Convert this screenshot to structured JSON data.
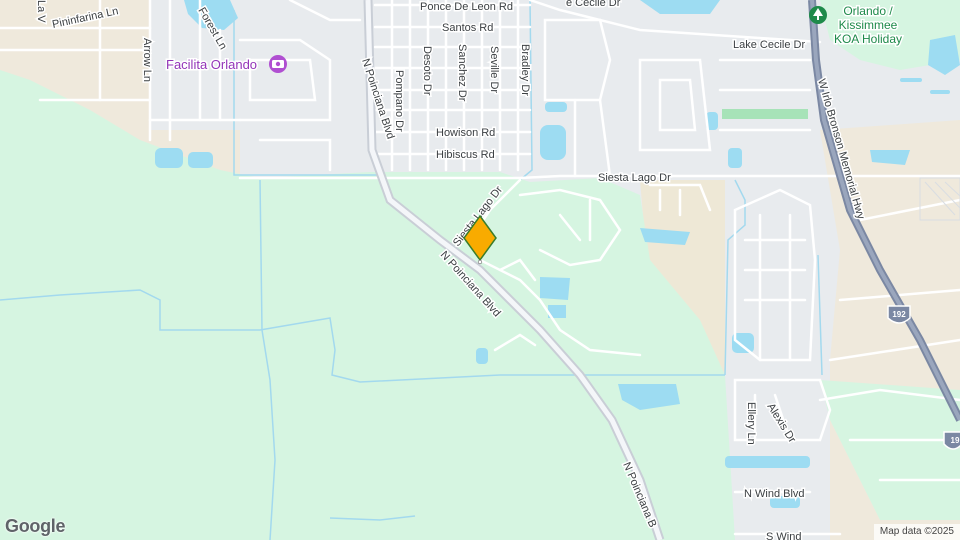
{
  "map": {
    "streets": {
      "ponce_de_leon": "Ponce De Leon Rd",
      "santos": "Santos Rd",
      "desoto": "Desoto Dr",
      "sanchez": "Sanchez Dr",
      "seville": "Seville Dr",
      "bradley": "Bradley Dr",
      "pompano": "Pompano Dr",
      "howison": "Howison Rd",
      "hibiscus": "Hibiscus Rd",
      "lake_cecile": "Lake Cecile Dr",
      "lake_cecile_top": "e Cecile Dr",
      "siesta_lago": "Siesta Lago Dr",
      "siesta_lago_curve": "Siesta Lago Dr",
      "n_poinciana_top": "N Poinciana Blvd",
      "n_poinciana_mid": "N Poinciana Blvd",
      "n_poinciana_bottom": "N Poinciana B",
      "pininfarina": "Pininfarina Ln",
      "arrow": "Arrow Ln",
      "forest": "Forest Ln",
      "la_v": "La V",
      "bronson": "W Irlo Bronson Memorial Hwy",
      "ellery": "Ellery Ln",
      "alexis": "Alexis Dr",
      "n_wind": "N Wind Blvd",
      "s_wind": "S Wind"
    },
    "poi": {
      "facilita": "Facilita Orlando",
      "koa_line1": "Orlando /",
      "koa_line2": "Kissimmee",
      "koa_line3": "KOA Holiday"
    },
    "shields": {
      "us192": "192",
      "us19": "19"
    },
    "marker": {
      "color": "#f9ab00",
      "icon": "location-pin-icon"
    },
    "colors": {
      "park": "#d6f5e1",
      "urban": "#e8ebee",
      "sand": "#efe9dc",
      "water": "#9ddcf2",
      "road": "#ffffff",
      "highway": "#8f9bb3"
    }
  },
  "footer": {
    "logo": "Google",
    "attribution": "Map data ©2025"
  }
}
